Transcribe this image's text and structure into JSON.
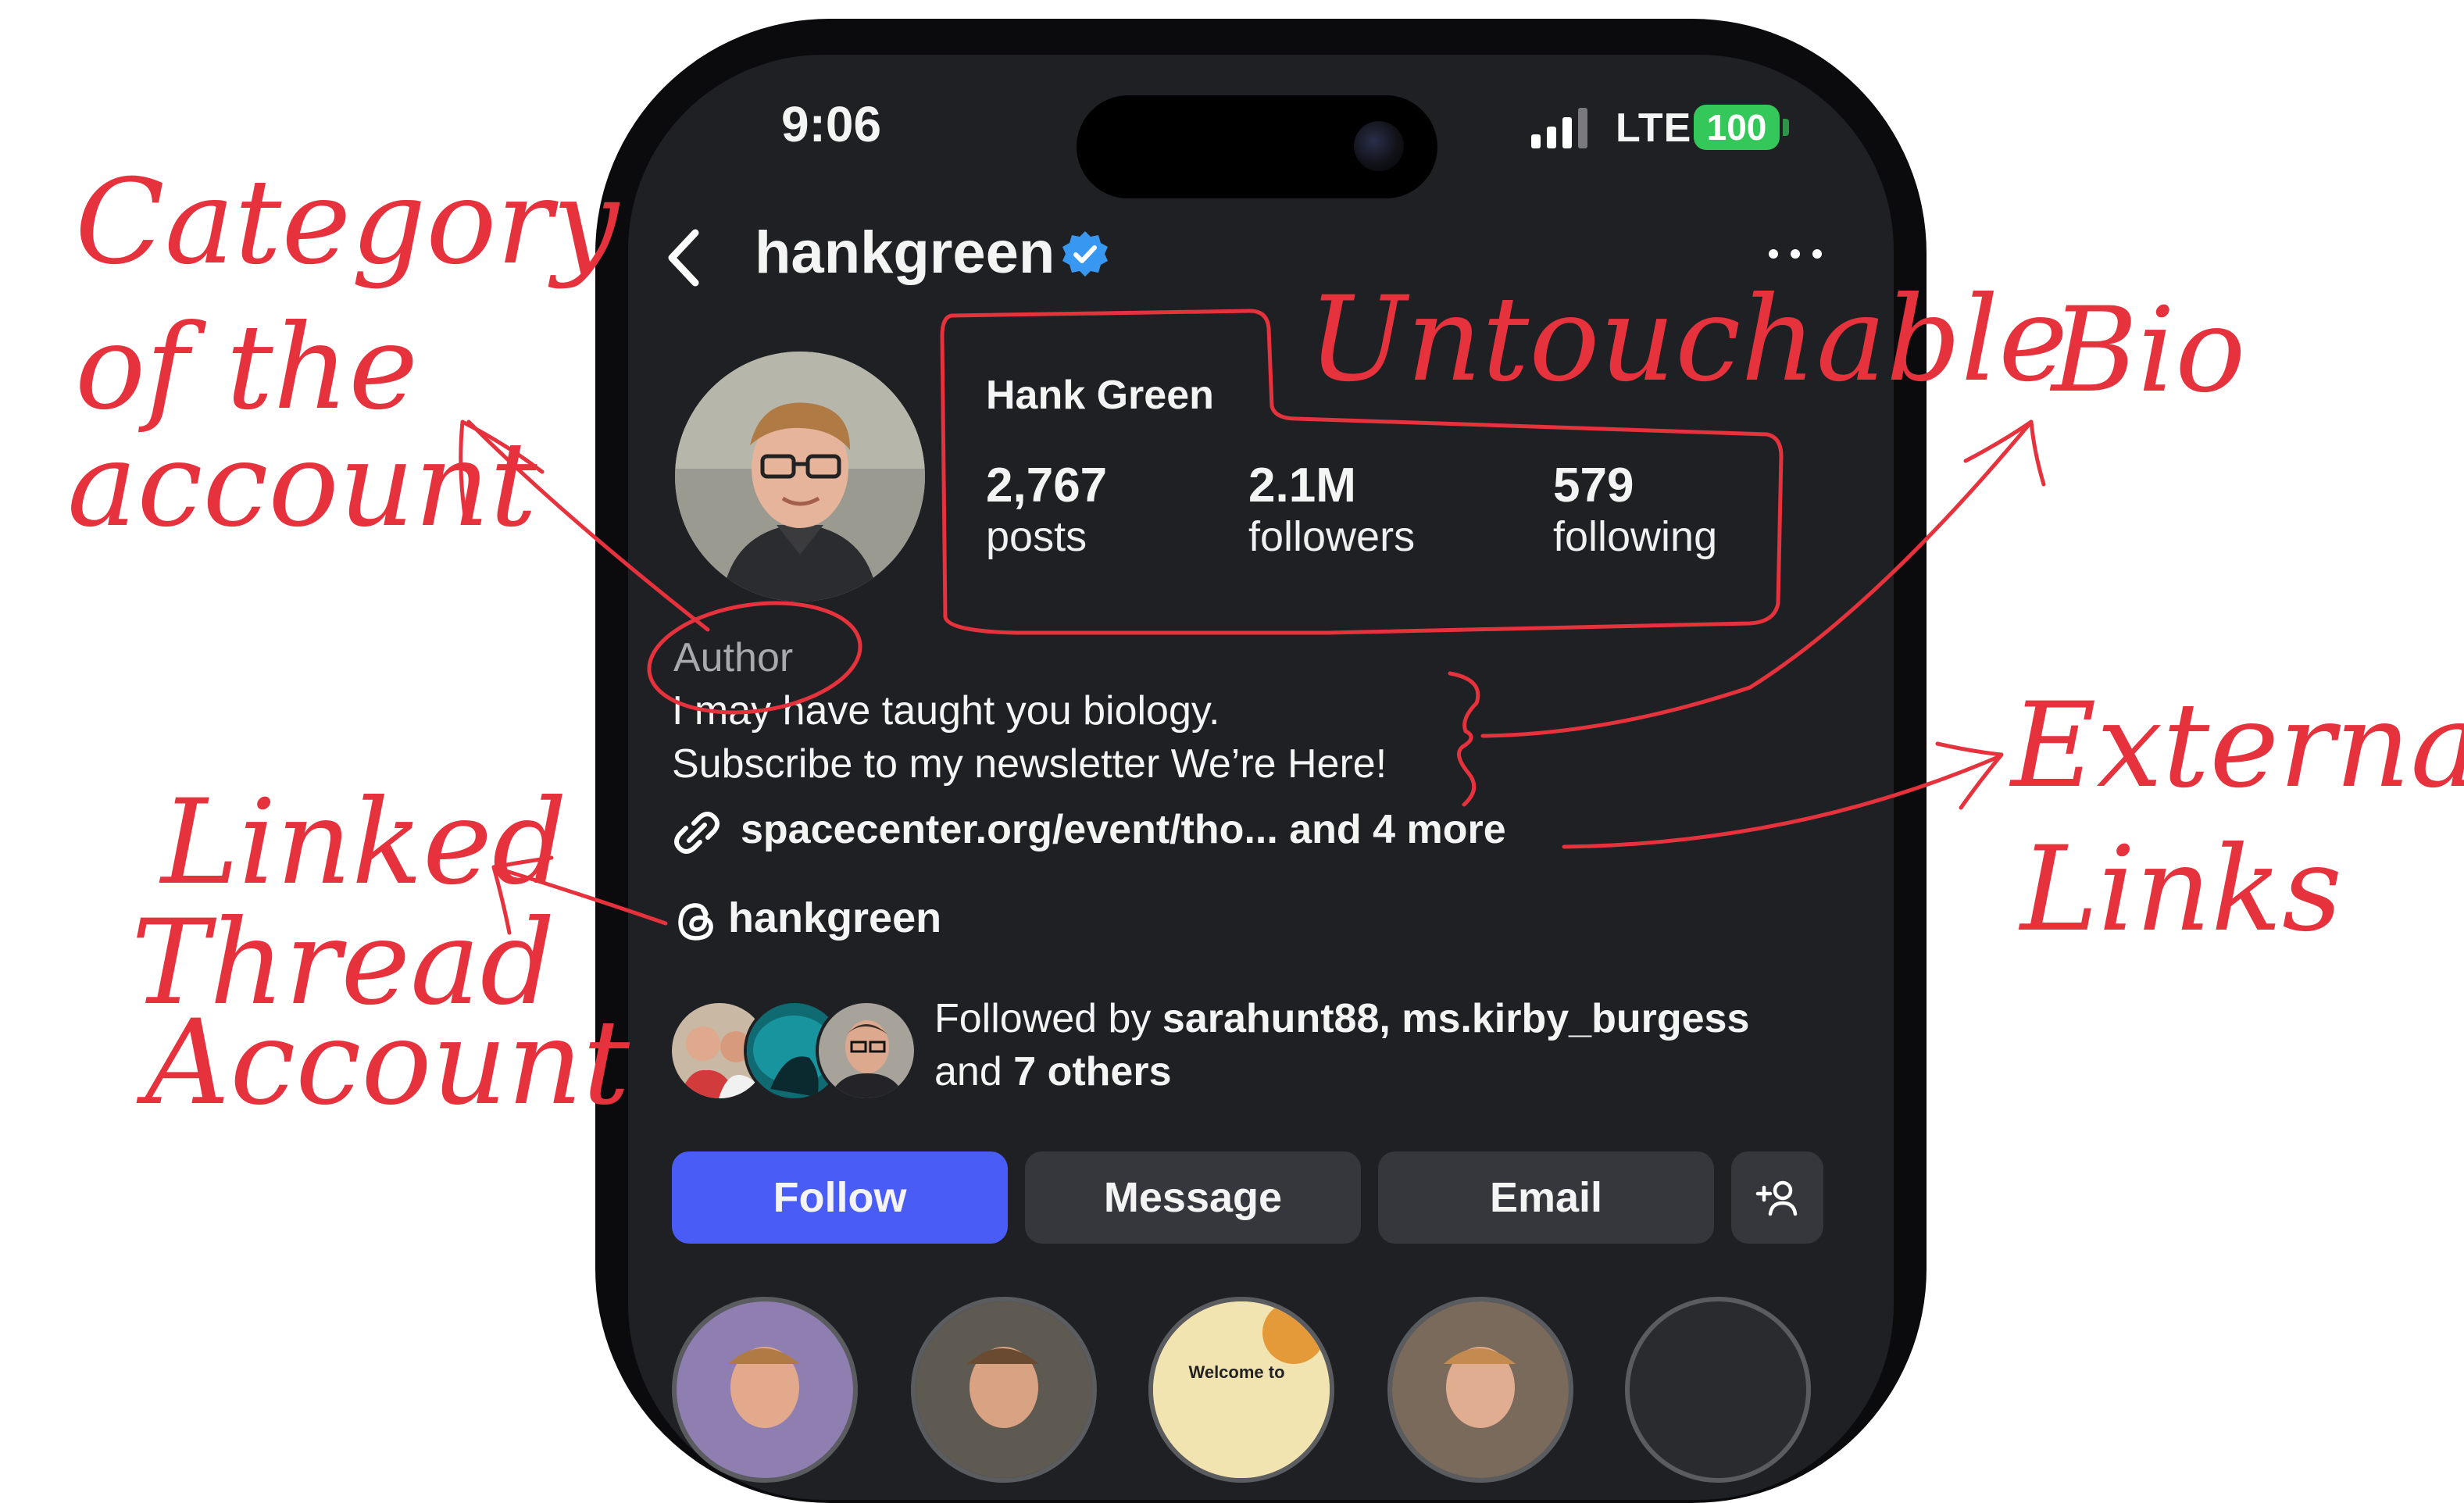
{
  "status_bar": {
    "time": "9:06",
    "network": "LTE",
    "battery": "100"
  },
  "header": {
    "username": "hankgreen",
    "back_icon": "chevron-left-icon",
    "verified_icon": "verified-badge-icon",
    "more_icon": "more-dots-icon"
  },
  "profile": {
    "full_name": "Hank Green",
    "stats": [
      {
        "value": "2,767",
        "label": "posts"
      },
      {
        "value": "2.1M",
        "label": "followers"
      },
      {
        "value": "579",
        "label": "following"
      }
    ],
    "category": "Author",
    "bio_lines": [
      "I may have taught you biology.",
      "Subscribe to my newsletter We’re Here!"
    ],
    "link": "spacecenter.org/event/tho...  and 4 more",
    "threads_handle": "hankgreen",
    "followed_by": {
      "prefix": "Followed by ",
      "names": "sarahunt88, ms.kirby_burgess",
      "line2_prefix": "and ",
      "others": "7 others"
    }
  },
  "buttons": {
    "follow": "Follow",
    "message": "Message",
    "email": "Email",
    "add_icon": "add-person-icon"
  },
  "highlights": {
    "third_label": "Welcome to"
  },
  "annotations": {
    "category": [
      "Category",
      "of the",
      "account"
    ],
    "untouchable": "Untouchable",
    "bio": "Bio",
    "external": [
      "External",
      "Links"
    ],
    "threads": [
      "Linked",
      "Thread",
      "Account"
    ]
  },
  "colors": {
    "annotation": "#e5323d",
    "follow_button": "#4a5cf6",
    "screen": "#1f2023",
    "verified": "#3897f0",
    "battery": "#34c759"
  }
}
